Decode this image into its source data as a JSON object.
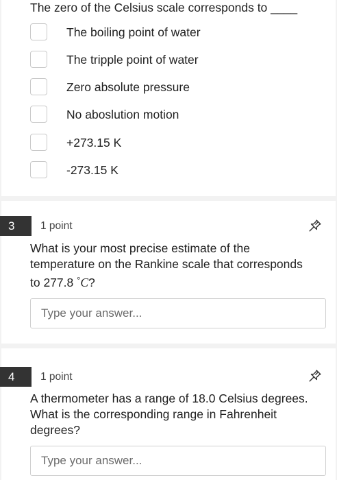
{
  "q2": {
    "prompt": "The zero of the Celsius scale corresponds to ____",
    "options": [
      "The boiling point of water",
      "The tripple point of water",
      "Zero absolute pressure",
      "No aboslution motion",
      "+273.15 K",
      "-273.15 K"
    ]
  },
  "q3": {
    "number": "3",
    "points": "1 point",
    "question_line1": "What is your most precise estimate of the",
    "question_line2": "temperature on the Rankine scale that corresponds",
    "question_line3_prefix": "to 277.8 ",
    "question_degree": "°",
    "question_unit": "C",
    "question_end": "?",
    "answer_placeholder": "Type your answer...",
    "answer_value": ""
  },
  "q4": {
    "number": "4",
    "points": "1 point",
    "question_line1": "A thermometer has a range of 18.0 Celsius degrees.",
    "question_line2": "What is the corresponding range in Fahrenheit",
    "question_line3": "degrees?",
    "answer_placeholder": "Type your answer...",
    "answer_value": ""
  },
  "icons": {
    "pin": "pin-icon"
  }
}
